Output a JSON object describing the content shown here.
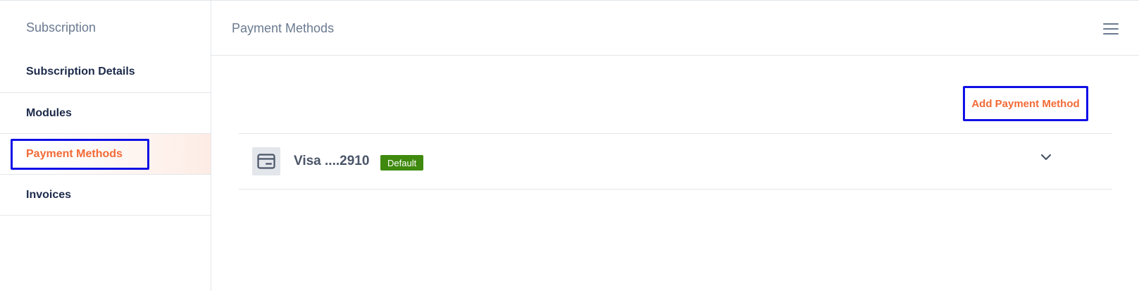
{
  "sidebar": {
    "title": "Subscription",
    "items": [
      {
        "label": "Subscription Details",
        "active": false
      },
      {
        "label": "Modules",
        "active": false
      },
      {
        "label": "Payment Methods",
        "active": true
      },
      {
        "label": "Invoices",
        "active": false
      }
    ]
  },
  "header": {
    "title": "Payment Methods",
    "menu_icon": "hamburger-menu-icon"
  },
  "actions": {
    "add_label": "Add Payment Method"
  },
  "payment_methods": [
    {
      "label": "Visa ....2910",
      "badge": "Default",
      "icon": "credit-card-icon"
    }
  ],
  "colors": {
    "accent": "#f26a36",
    "nav_text": "#1c2a4a",
    "muted_text": "#6a7a90",
    "badge_bg": "#3f8a0e",
    "highlight": "#1010e6",
    "border": "#e3e6ea"
  }
}
